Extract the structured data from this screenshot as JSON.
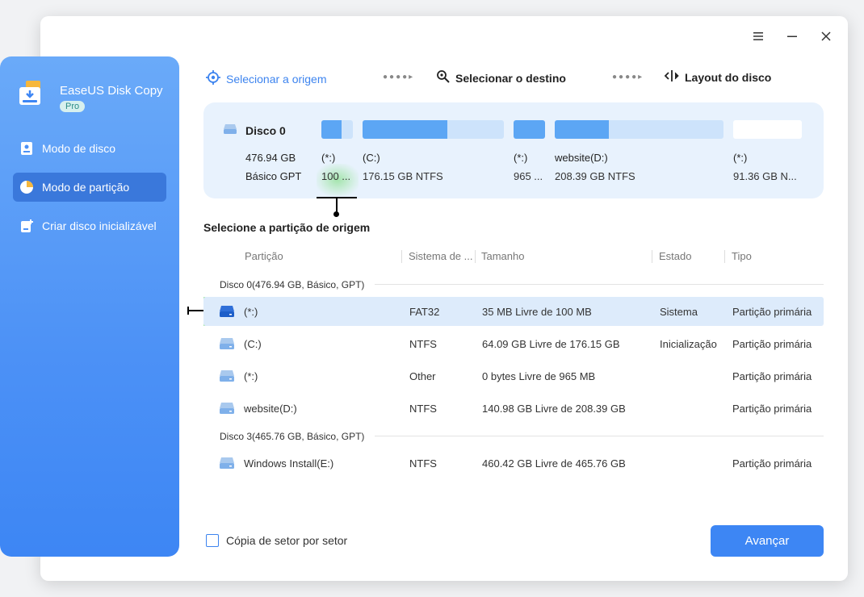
{
  "app": {
    "title": "EaseUS Disk Copy",
    "badge": "Pro"
  },
  "sidebar": {
    "items": [
      {
        "label": "Modo de disco",
        "icon": "disk-mode-icon",
        "active": false
      },
      {
        "label": "Modo de partição",
        "icon": "partition-mode-icon",
        "active": true
      },
      {
        "label": "Criar disco inicializável",
        "icon": "bootable-disk-icon",
        "active": false
      }
    ]
  },
  "steps": [
    {
      "label": "Selecionar a origem",
      "icon": "target-icon",
      "active": true
    },
    {
      "label": "Selecionar o destino",
      "icon": "destination-search-icon",
      "active": false
    },
    {
      "label": "Layout do disco",
      "icon": "layout-icon",
      "active": false
    }
  ],
  "disk_panel": {
    "name": "Disco 0",
    "size": "476.94 GB",
    "type": "Básico GPT",
    "partitions": [
      {
        "label": "(*:)",
        "info": "100 ...",
        "used_fraction": 0.65
      },
      {
        "label": "(C:)",
        "info": "176.15 GB NTFS",
        "used_fraction": 0.6
      },
      {
        "label": "(*:)",
        "info": "965 ...",
        "used_fraction": 1.0
      },
      {
        "label": "website(D:)",
        "info": "208.39 GB NTFS",
        "used_fraction": 0.32
      },
      {
        "label": "(*:)",
        "info": "91.36 GB N...",
        "used_fraction": 0.0
      }
    ]
  },
  "section_title": "Selecione a partição de origem",
  "table": {
    "headers": [
      "Partição",
      "Sistema de ...",
      "Tamanho",
      "Estado",
      "Tipo"
    ],
    "groups": [
      {
        "title": "Disco 0(476.94 GB, Básico, GPT)",
        "rows": [
          {
            "name": "(*:)",
            "fs": "FAT32",
            "size": "35 MB Livre de 100 MB",
            "state": "Sistema",
            "type": "Partição primária"
          },
          {
            "name": "(C:)",
            "fs": "NTFS",
            "size": "64.09 GB Livre de 176.15 GB",
            "state": "Inicialização",
            "type": "Partição primária"
          },
          {
            "name": "(*:)",
            "fs": "Other",
            "size": "0 bytes Livre de 965 MB",
            "state": "",
            "type": "Partição primária"
          },
          {
            "name": "website(D:)",
            "fs": "NTFS",
            "size": "140.98 GB Livre de 208.39 GB",
            "state": "",
            "type": "Partição primária"
          }
        ]
      },
      {
        "title": "Disco 3(465.76 GB, Básico, GPT)",
        "rows": [
          {
            "name": "Windows Install(E:)",
            "fs": "NTFS",
            "size": "460.42 GB Livre de 465.76 GB",
            "state": "",
            "type": "Partição primária"
          }
        ]
      }
    ]
  },
  "footer": {
    "checkbox_label": "Cópia de setor por setor",
    "checked": false,
    "next_label": "Avançar"
  },
  "colors": {
    "accent": "#3d86f4",
    "sidebar_top": "#6aaaf9",
    "sidebar_bottom": "#3d86f4",
    "bar_fill": "#5ca6f4",
    "bar_bg": "#cde3fb"
  }
}
